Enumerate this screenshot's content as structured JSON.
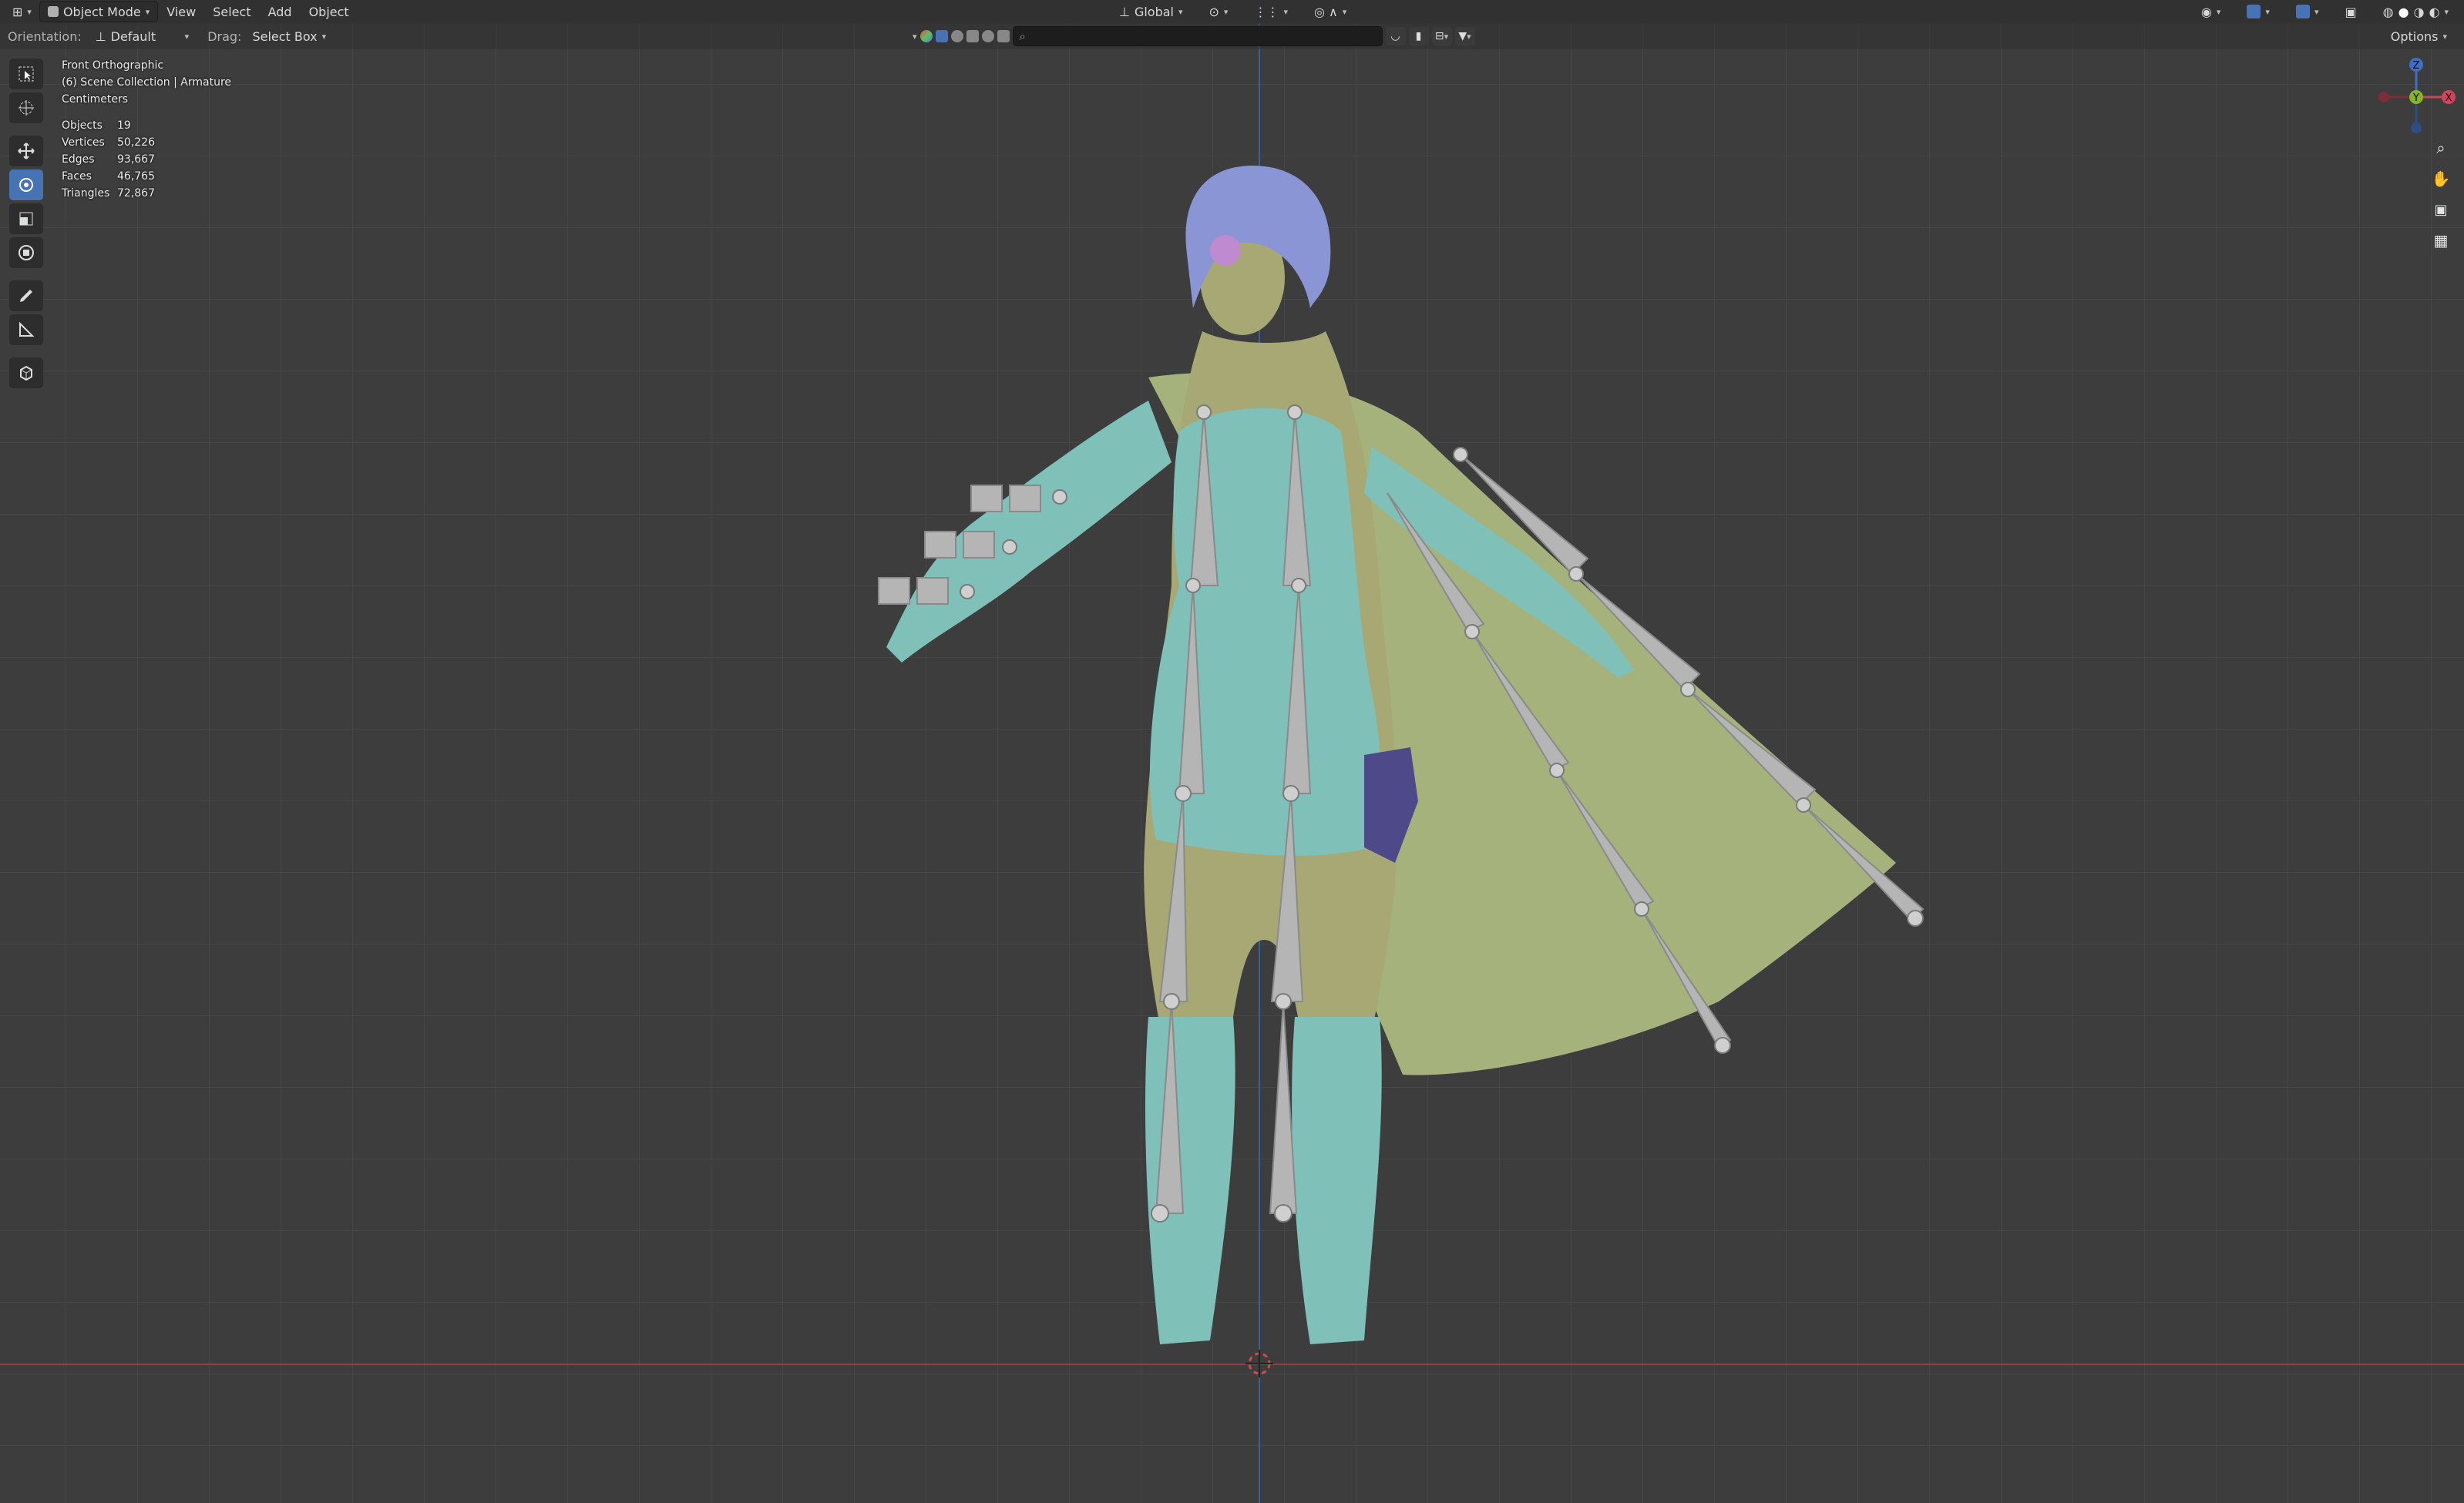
{
  "header": {
    "mode": "Object Mode",
    "menus": [
      "View",
      "Select",
      "Add",
      "Object"
    ],
    "transform_orientation": "Global",
    "options": "Options"
  },
  "tool_header": {
    "orientation_label": "Orientation:",
    "orientation_value": "Default",
    "drag_label": "Drag:",
    "drag_value": "Select Box"
  },
  "overlay": {
    "view_name": "Front Orthographic",
    "collection": "(6) Scene Collection | Armature",
    "units": "Centimeters",
    "stats": [
      {
        "label": "Objects",
        "value": "19"
      },
      {
        "label": "Vertices",
        "value": "50,226"
      },
      {
        "label": "Edges",
        "value": "93,667"
      },
      {
        "label": "Faces",
        "value": "46,765"
      },
      {
        "label": "Triangles",
        "value": "72,867"
      }
    ]
  },
  "gizmo": {
    "z": "Z",
    "y": "Y",
    "x": "X"
  },
  "colors": {
    "background": "#3d3d3d",
    "grid": "#464646",
    "x_axis": "#9b3b44",
    "z_axis": "#3a5f9e",
    "active_tool": "#4772b3",
    "cloak": "#a6b27c",
    "cloth": "#7fc0b9",
    "hair": "#8a95d6",
    "bone": "#b5b5b5"
  },
  "tools": [
    "select-box",
    "cursor",
    "move",
    "rotate",
    "scale",
    "transform",
    "annotate",
    "measure",
    "add-cube"
  ],
  "view_controls": [
    "zoom",
    "pan",
    "camera",
    "ortho-grid"
  ]
}
